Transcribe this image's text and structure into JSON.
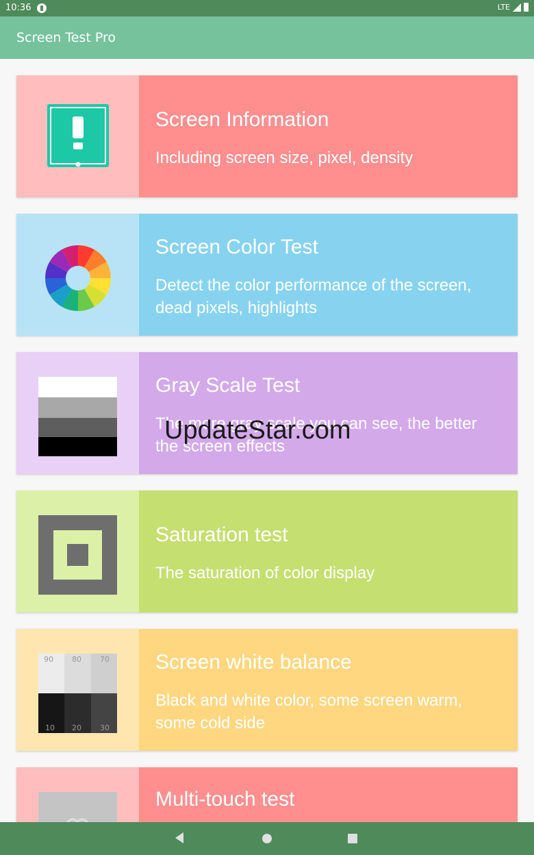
{
  "status_bar": {
    "time": "10:36",
    "network": "LTE"
  },
  "app_bar": {
    "title": "Screen Test Pro"
  },
  "cards": [
    {
      "title": "Screen Information",
      "description": "Including screen size, pixel, density",
      "icon": "info-screen-icon",
      "panel_color": "#ffbdbd",
      "text_color_bg": "#ff8f8f"
    },
    {
      "title": "Screen Color Test",
      "description": "Detect the color performance of the screen, dead pixels, highlights",
      "icon": "color-wheel-icon",
      "panel_color": "#b8e3f6",
      "text_color_bg": "#87d3ef"
    },
    {
      "title": "Gray Scale Test",
      "description": "The more gray scale you can see, the better the screen effects",
      "icon": "grayscale-icon",
      "panel_color": "#e8d0f6",
      "text_color_bg": "#d3a9ea"
    },
    {
      "title": "Saturation test",
      "description": "The saturation of color display",
      "icon": "saturation-icon",
      "panel_color": "#dcf0a8",
      "text_color_bg": "#c5df71"
    },
    {
      "title": "Screen white balance",
      "description": "Black and white color, some screen warm, some cold side",
      "icon": "white-balance-icon",
      "panel_color": "#ffe6b1",
      "text_color_bg": "#ffd781",
      "grid_labels": [
        "90",
        "80",
        "70",
        "10",
        "20",
        "30"
      ]
    },
    {
      "title": "Multi-touch test",
      "description": "",
      "icon": "multi-touch-icon",
      "panel_color": "#ffbdbd",
      "text_color_bg": "#ff8f8f"
    }
  ],
  "watermark": "UpdateStar.com"
}
